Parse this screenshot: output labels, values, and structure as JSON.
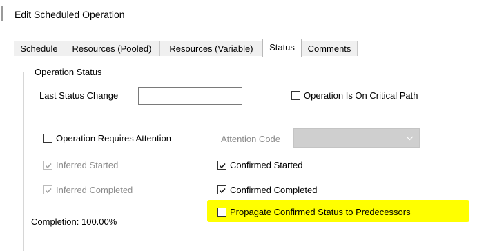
{
  "window": {
    "title": "Edit Scheduled Operation"
  },
  "tabs": [
    {
      "label": "Schedule",
      "active": false
    },
    {
      "label": "Resources (Pooled)",
      "active": false
    },
    {
      "label": "Resources (Variable)",
      "active": false
    },
    {
      "label": "Status",
      "active": true
    },
    {
      "label": "Comments",
      "active": false
    }
  ],
  "group": {
    "label": "Operation Status",
    "last_status_change": {
      "label": "Last Status Change",
      "value": ""
    },
    "critical_path": {
      "label": "Operation Is On Critical Path",
      "checked": false
    },
    "requires_attention": {
      "label": "Operation Requires Attention",
      "checked": false
    },
    "attention_code": {
      "label": "Attention Code",
      "value": ""
    },
    "inferred_started": {
      "label": "Inferred Started",
      "checked": true
    },
    "inferred_completed": {
      "label": "Inferred Completed",
      "checked": true
    },
    "confirmed_started": {
      "label": "Confirmed Started",
      "checked": true
    },
    "confirmed_completed": {
      "label": "Confirmed Completed",
      "checked": true
    },
    "propagate": {
      "label": "Propagate Confirmed Status to Predecessors",
      "checked": false
    },
    "completion": "Completion: 100.00%"
  },
  "colors": {
    "highlight": "#ffff00",
    "disabled_text": "#8c8c8c"
  }
}
